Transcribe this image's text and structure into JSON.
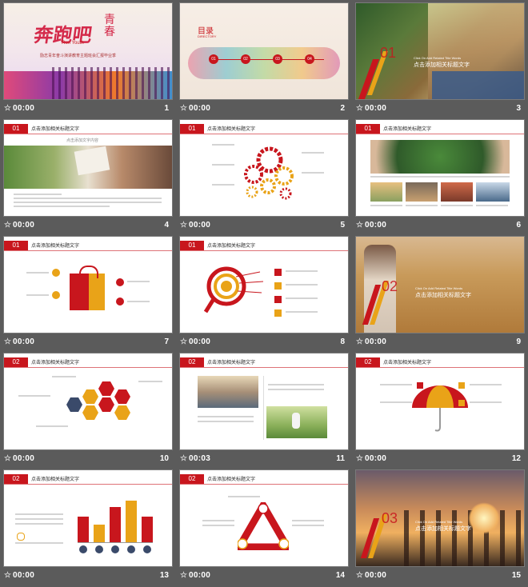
{
  "thumb_time": "00:00",
  "slides": [
    {
      "n": "1",
      "time": "00:00",
      "title": "奔跑吧",
      "title2": "青春",
      "subtitle": "Run Youth",
      "tagline": "励志青年奋斗演讲教育主题班会汇报毕业季"
    },
    {
      "n": "2",
      "time": "00:00",
      "toc_title": "目录",
      "toc_en": "DIRECTORY",
      "steps": [
        "01",
        "02",
        "03",
        "04"
      ]
    },
    {
      "n": "3",
      "time": "00:00",
      "big": "01",
      "line1": "Click On Add Related Title Words",
      "line2": "点击添加相关标题文字"
    },
    {
      "n": "4",
      "time": "00:00",
      "badge": "01",
      "header": "点击添加相关标题文字",
      "caption": "点击添加文字内容"
    },
    {
      "n": "5",
      "time": "00:00",
      "badge": "01",
      "header": "点击添加相关标题文字"
    },
    {
      "n": "6",
      "time": "00:00",
      "badge": "01",
      "header": "点击添加相关标题文字"
    },
    {
      "n": "7",
      "time": "00:00",
      "badge": "01",
      "header": "点击添加相关标题文字"
    },
    {
      "n": "8",
      "time": "00:00",
      "badge": "01",
      "header": "点击添加相关标题文字"
    },
    {
      "n": "9",
      "time": "00:00",
      "big": "02",
      "line1": "Click On Add Related Title Words",
      "line2": "点击添加相关标题文字"
    },
    {
      "n": "10",
      "time": "00:00",
      "badge": "02",
      "header": "点击添加相关标题文字"
    },
    {
      "n": "11",
      "time": "00:03",
      "badge": "02",
      "header": "点击添加相关标题文字"
    },
    {
      "n": "12",
      "time": "00:00",
      "badge": "02",
      "header": "点击添加相关标题文字"
    },
    {
      "n": "13",
      "time": "00:00",
      "badge": "02",
      "header": "点击添加相关标题文字"
    },
    {
      "n": "14",
      "time": "00:00",
      "badge": "02",
      "header": "点击添加相关标题文字"
    },
    {
      "n": "15",
      "time": "00:00",
      "big": "03",
      "line1": "Click On Add Related Title Words",
      "line2": "点击添加相关标题文字"
    }
  ],
  "colors": {
    "accent": "#c8161d",
    "gold": "#e9a318",
    "bg": "#5b5b5b"
  }
}
